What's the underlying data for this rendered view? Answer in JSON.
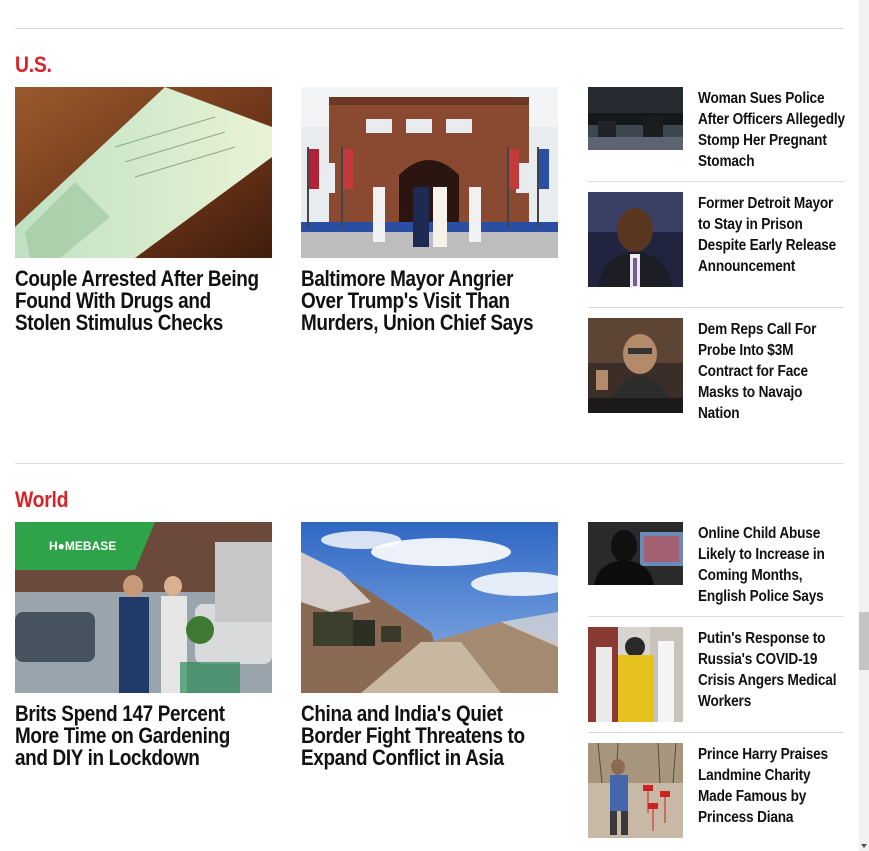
{
  "sections": [
    {
      "title": "U.S.",
      "featured": [
        {
          "headline": "Couple Arrested After Being Found With Drugs and Stolen Stimulus Checks",
          "image": "stimulus-check-photo"
        },
        {
          "headline": "Baltimore Mayor Angrier Over Trump's Visit Than Murders, Union Chief Says",
          "image": "fort-mchenry-visit-photo"
        }
      ],
      "side": [
        {
          "headline": "Woman Sues Police After Officers Allegedly Stomp Her Pregnant Stomach",
          "image": "police-officer-belt-photo"
        },
        {
          "headline": "Former Detroit Mayor to Stay in Prison Despite Early Release Announcement",
          "image": "former-mayor-portrait-photo"
        },
        {
          "headline": "Dem Reps Call For Probe Into $3M Contract for Face Masks to Navajo Nation",
          "image": "congressman-hearing-photo"
        }
      ]
    },
    {
      "title": "World",
      "featured": [
        {
          "headline": "Brits Spend 147 Percent More Time on Gardening and DIY in Lockdown",
          "image": "homebase-shoppers-photo"
        },
        {
          "headline": "China and India's Quiet Border Fight Threatens to Expand Conflict in Asia",
          "image": "mountain-road-trucks-photo"
        }
      ],
      "side": [
        {
          "headline": "Online Child Abuse Likely to Increase in Coming Months, English Police Says",
          "image": "silhouette-computer-photo"
        },
        {
          "headline": "Putin's Response to Russia's COVID-19 Crisis Angers Medical Workers",
          "image": "hazmat-workers-photo"
        },
        {
          "headline": "Prince Harry Praises Landmine Charity Made Famous by Princess Diana",
          "image": "landmine-field-photo"
        }
      ]
    }
  ],
  "images": {
    "stimulus-check-photo": "stimulus check",
    "homebase_sign": "H●MEBASE"
  },
  "colors": {
    "accent": "#d8232a",
    "rule": "#dcdcdc",
    "text": "#111111"
  }
}
